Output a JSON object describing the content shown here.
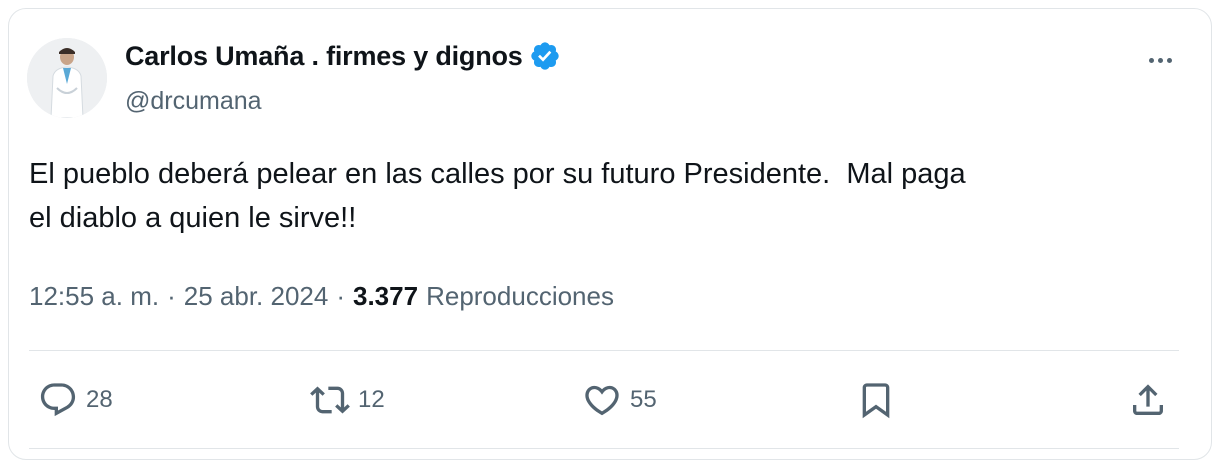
{
  "tweet": {
    "author_name": "Carlos Umaña . firmes y dignos",
    "handle": "@drcumana",
    "text": "El pueblo deberá pelear en las calles por su futuro Presidente.  Mal paga\nel diablo a quien le sirve!!",
    "time": "12:55 a. m.",
    "separator": "·",
    "date": "25 abr. 2024",
    "views_count": "3.377",
    "views_label": "Reproducciones"
  },
  "actions": {
    "replies": "28",
    "retweets": "12",
    "likes": "55"
  },
  "colors": {
    "verified": "#1d9bf0",
    "muted": "#536471",
    "text": "#0f1419",
    "divider": "#e1e5e8"
  },
  "icons": [
    "verified-badge-icon",
    "more-options-icon",
    "reply-icon",
    "retweet-icon",
    "like-icon",
    "bookmark-icon",
    "share-icon"
  ]
}
